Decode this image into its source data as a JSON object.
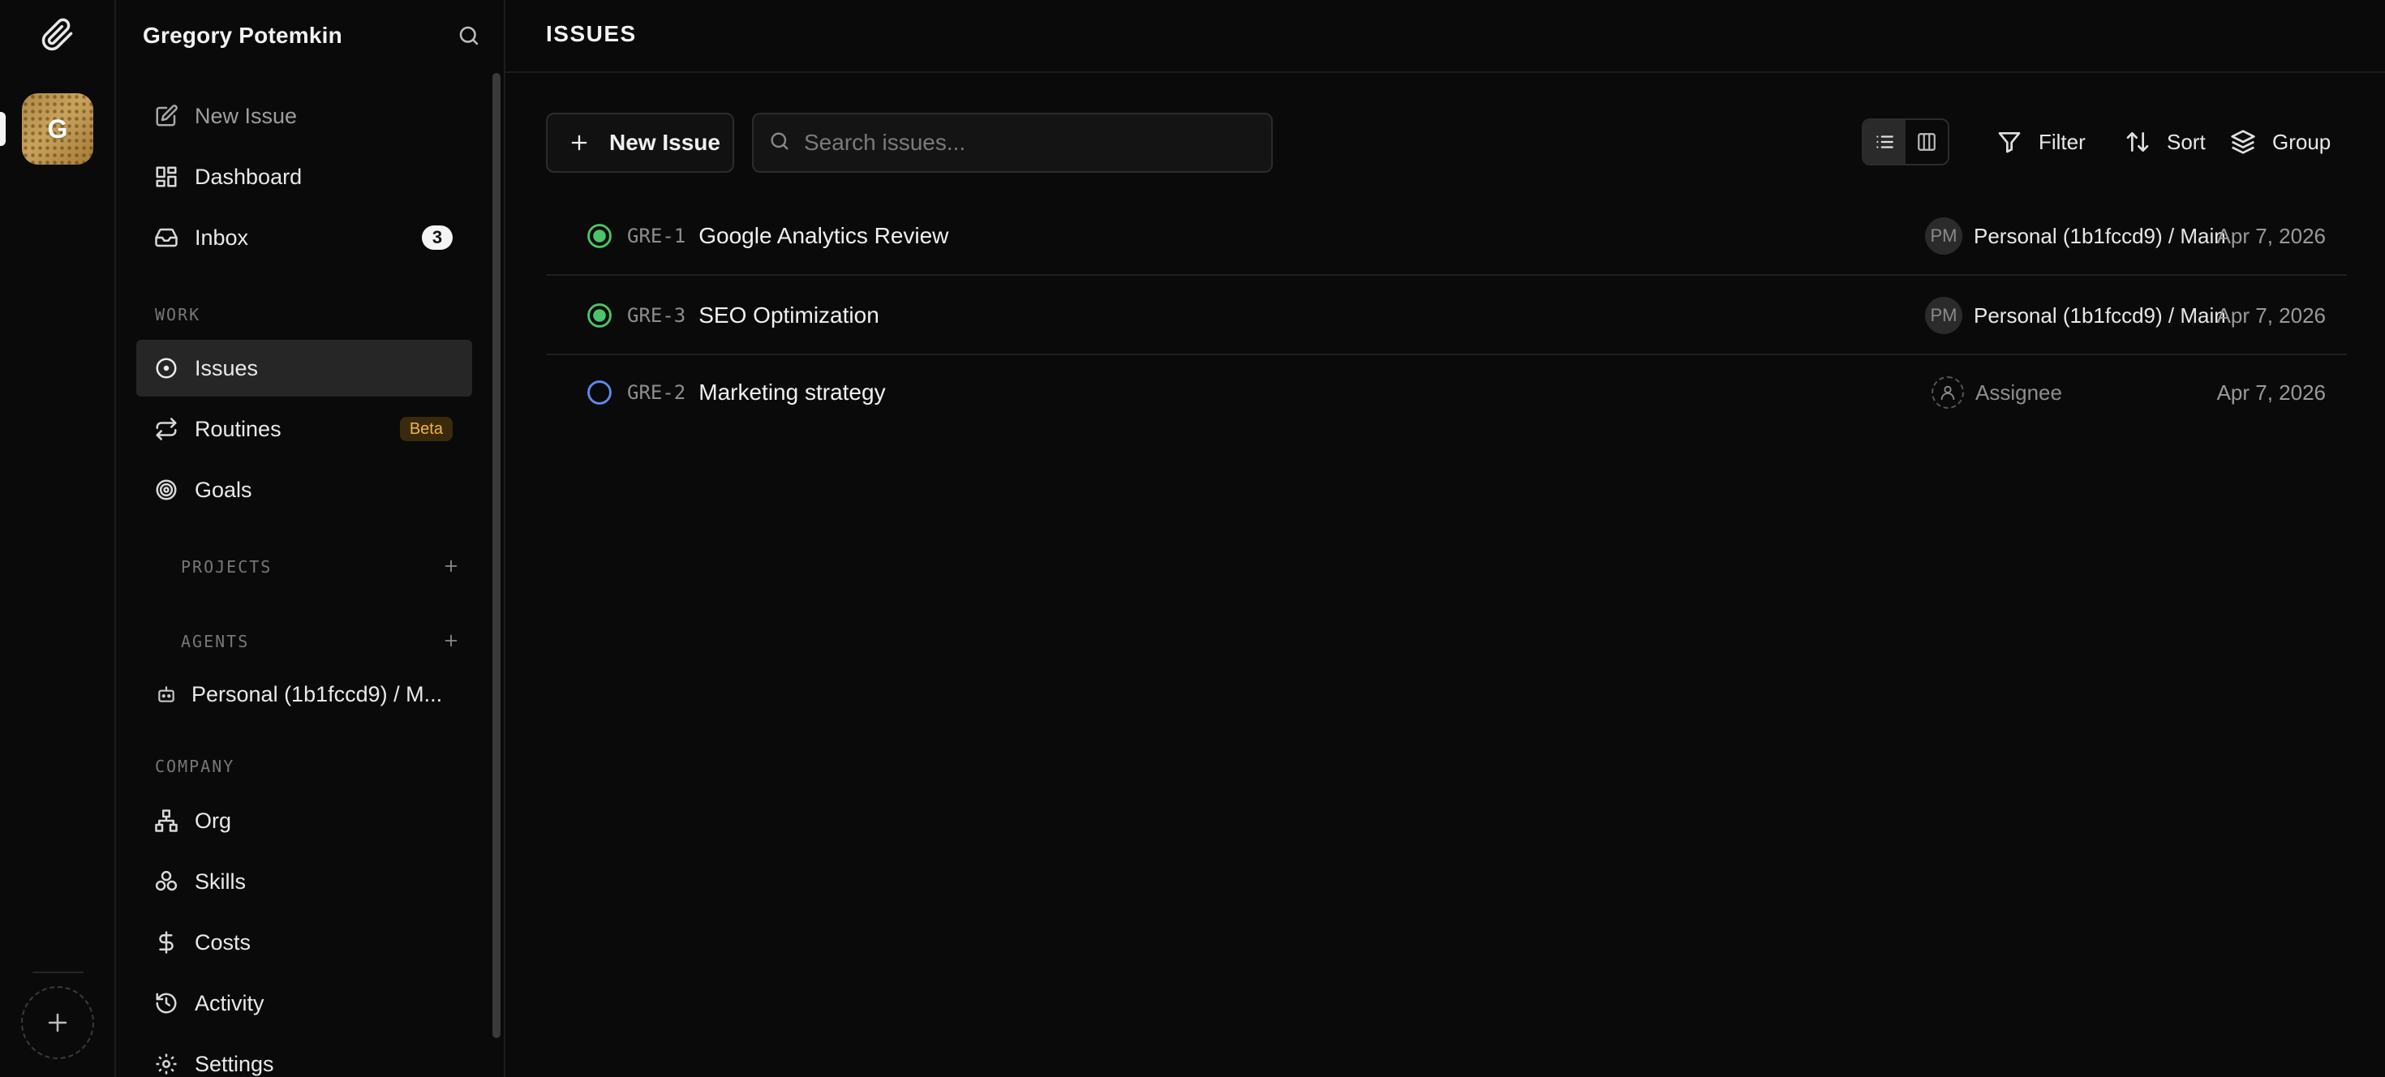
{
  "rail": {
    "avatar_letter": "G",
    "icons": {
      "logo": "paperclip-icon",
      "add": "plus-icon"
    }
  },
  "sidebar": {
    "company_name": "Gregory Potemkin",
    "top_items": [
      {
        "label": "New Issue",
        "icon": "pencil-square-icon"
      },
      {
        "label": "Dashboard",
        "icon": "dashboard-icon"
      },
      {
        "label": "Inbox",
        "icon": "inbox-icon",
        "badge": "3"
      }
    ],
    "sections": {
      "work": "WORK",
      "projects": "PROJECTS",
      "agents": "AGENTS",
      "company": "COMPANY"
    },
    "work_items": [
      {
        "label": "Issues",
        "icon": "circle-dot-icon",
        "active": true
      },
      {
        "label": "Routines",
        "icon": "repeat-icon",
        "badge": "Beta"
      },
      {
        "label": "Goals",
        "icon": "target-icon"
      }
    ],
    "agents": [
      {
        "label": "Personal (1b1fccd9) / M...",
        "icon": "bot-icon"
      }
    ],
    "company_items": [
      {
        "label": "Org",
        "icon": "org-chart-icon"
      },
      {
        "label": "Skills",
        "icon": "skills-icon"
      },
      {
        "label": "Costs",
        "icon": "dollar-icon"
      },
      {
        "label": "Activity",
        "icon": "history-icon"
      },
      {
        "label": "Settings",
        "icon": "gear-icon"
      }
    ]
  },
  "main": {
    "page_title": "ISSUES",
    "toolbar": {
      "new_issue_label": "New Issue",
      "search_placeholder": "Search issues...",
      "search_value": "",
      "view_mode": "list",
      "filter_label": "Filter",
      "sort_label": "Sort",
      "group_label": "Group"
    },
    "issues": [
      {
        "id": "GRE-1",
        "title": "Google Analytics Review",
        "status": "done",
        "assignee_initials": "PM",
        "assignee": "Personal (1b1fccd9) / Main",
        "date": "Apr 7, 2026"
      },
      {
        "id": "GRE-3",
        "title": "SEO Optimization",
        "status": "done",
        "assignee_initials": "PM",
        "assignee": "Personal (1b1fccd9) / Main",
        "date": "Apr 7, 2026"
      },
      {
        "id": "GRE-2",
        "title": "Marketing strategy",
        "status": "todo",
        "assignee_initials": "",
        "assignee": "Assignee",
        "date": "Apr 7, 2026"
      }
    ]
  },
  "colors": {
    "background": "#0a0a0a",
    "status_done": "#4cc46a",
    "status_todo": "#5b8def",
    "beta_text": "#f0b24a",
    "active_item": "#262626"
  }
}
